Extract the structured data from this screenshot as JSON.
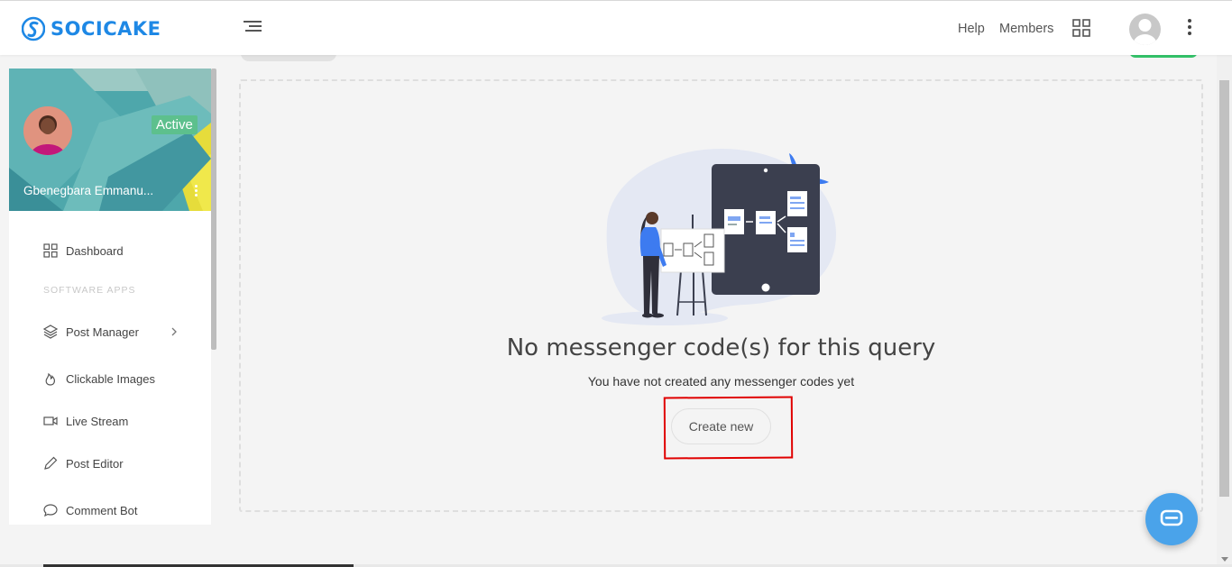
{
  "brand": {
    "name": "SOCICAKE",
    "color": "#1e88e5"
  },
  "topbar": {
    "help_label": "Help",
    "members_label": "Members",
    "icons": [
      "menu-icon",
      "apps-grid-icon",
      "user-avatar-icon",
      "more-vertical-icon"
    ]
  },
  "profile": {
    "name": "Gbenegbara Emmanu...",
    "status": "Active",
    "status_color": "#5dc08d"
  },
  "sidebar": {
    "items": [
      {
        "label": "Dashboard",
        "icon": "dashboard-icon"
      },
      {
        "label": "Post Manager",
        "icon": "layers-icon",
        "has_submenu": true
      },
      {
        "label": "Clickable Images",
        "icon": "fire-icon"
      },
      {
        "label": "Live Stream",
        "icon": "video-icon"
      },
      {
        "label": "Post Editor",
        "icon": "pencil-icon"
      },
      {
        "label": "Comment Bot",
        "icon": "comment-icon"
      }
    ],
    "section_heading": "SOFTWARE APPS"
  },
  "empty_state": {
    "title": "No messenger code(s) for this query",
    "subtitle": "You have not created any messenger codes yet",
    "button_label": "Create new",
    "illustration": "presentation-tablet-illustration"
  },
  "chat_widget": {
    "icon": "chat-bubble-icon",
    "color": "#4aa3ea"
  },
  "colors": {
    "accent": "#1e88e5",
    "success": "#34c46a",
    "highlight": "#e00000"
  }
}
